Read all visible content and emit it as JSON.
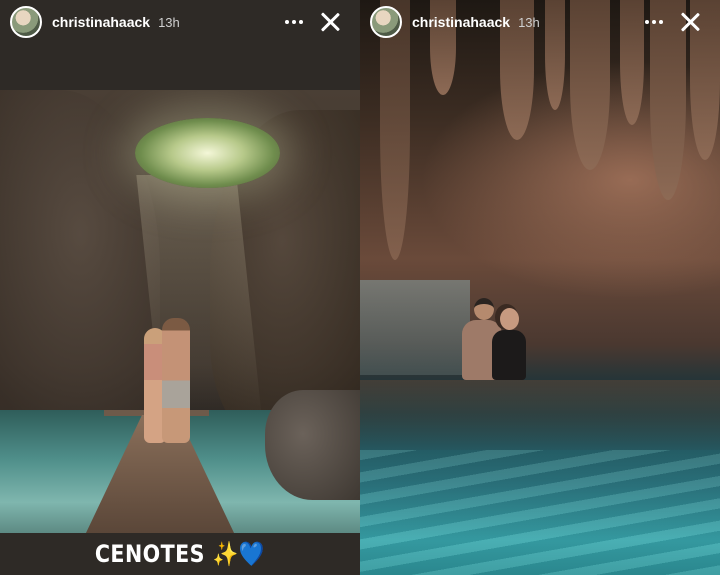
{
  "stories": [
    {
      "username": "christinahaack",
      "timestamp": "13h",
      "caption": "CENOTES ✨💙"
    },
    {
      "username": "christinahaack",
      "timestamp": "13h"
    }
  ],
  "icons": {
    "more": "more-horizontal-icon",
    "close": "close-icon",
    "avatar": "profile-avatar"
  },
  "colors": {
    "header_text": "#ffffff",
    "timestamp_text": "#cfcfcf",
    "caption_bar": "#2e2a26"
  }
}
